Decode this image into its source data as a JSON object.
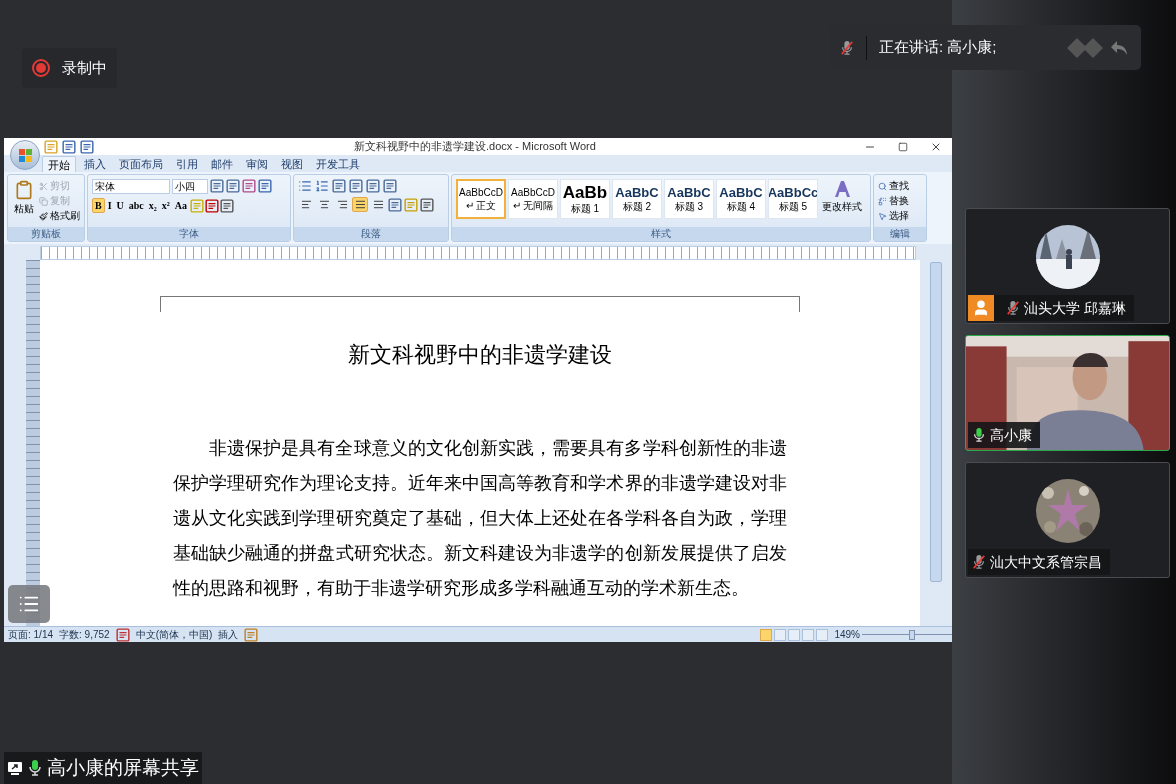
{
  "recording": {
    "on": true,
    "label": "录制中"
  },
  "speaker_bar": {
    "muted": true,
    "text": "正在讲话: 高小康;"
  },
  "word": {
    "title": "新文科视野中的非遗学建设.docx - Microsoft Word",
    "tabs": [
      {
        "label": "开始",
        "selected": true
      },
      {
        "label": "插入",
        "selected": false
      },
      {
        "label": "页面布局",
        "selected": false
      },
      {
        "label": "引用",
        "selected": false
      },
      {
        "label": "邮件",
        "selected": false
      },
      {
        "label": "审阅",
        "selected": false
      },
      {
        "label": "视图",
        "selected": false
      },
      {
        "label": "开发工具",
        "selected": false
      }
    ],
    "clipboard": {
      "paste": "粘贴",
      "items": [
        {
          "label": "剪切",
          "disabled": true
        },
        {
          "label": "复制",
          "disabled": true
        },
        {
          "label": "格式刷",
          "disabled": false
        }
      ],
      "title": "剪贴板"
    },
    "font": {
      "name": "宋体",
      "size": "小四",
      "title": "字体",
      "buttons": [
        {
          "label": "B",
          "selected": true
        },
        {
          "label": "I",
          "selected": false
        },
        {
          "label": "U",
          "selected": false
        },
        {
          "label": "abc",
          "selected": false
        },
        {
          "label": "x₂",
          "selected": false
        },
        {
          "label": "x²",
          "selected": false
        },
        {
          "label": "Aa",
          "selected": false
        }
      ]
    },
    "paragraph": {
      "title": "段落",
      "alignments": [
        {
          "kind": "left",
          "selected": false
        },
        {
          "kind": "center",
          "selected": false
        },
        {
          "kind": "right",
          "selected": false
        },
        {
          "kind": "justify",
          "selected": true
        },
        {
          "kind": "distributed",
          "selected": false
        }
      ]
    },
    "styles": {
      "title": "样式",
      "change": "更改样式",
      "items": [
        {
          "preview": "AaBbCcD",
          "label": "↵ 正文",
          "selected": true
        },
        {
          "preview": "AaBbCcD",
          "label": "↵ 无间隔",
          "selected": false
        },
        {
          "preview": "AaBb",
          "label": "标题 1",
          "selected": false
        },
        {
          "preview": "AaBbC",
          "label": "标题 2",
          "selected": false
        },
        {
          "preview": "AaBbC",
          "label": "标题 3",
          "selected": false
        },
        {
          "preview": "AaBbC",
          "label": "标题 4",
          "selected": false
        },
        {
          "preview": "AaBbCc",
          "label": "标题 5",
          "selected": false
        }
      ]
    },
    "editing": {
      "title": "编辑",
      "items": [
        {
          "kind": "find",
          "label": "查找"
        },
        {
          "kind": "replace",
          "label": "替换"
        },
        {
          "kind": "select",
          "label": "选择"
        }
      ]
    },
    "document": {
      "heading": "新文科视野中的非遗学建设",
      "paragraph": "非遗保护是具有全球意义的文化创新实践，需要具有多学科创新性的非遗保护学理研究作为理论支持。近年来中国高等教育和学术界的非遗学建设对非遗从文化实践到学理研究奠定了基础，但大体上还处在各学科各自为政，学理基础缺少融通的拼盘式研究状态。新文科建设为非遗学的创新发展提供了启发性的思路和视野，有助于非遗学研究形成多学科融通互动的学术新生态。"
    },
    "status_bar": {
      "page": "页面: 1/14",
      "words": "字数: 9,752",
      "language": "中文(简体，中国)",
      "mode": "插入",
      "zoom": "149%",
      "zoom_slider": {
        "level": 0.55
      },
      "views": [
        {
          "selected": true
        },
        {
          "selected": false
        },
        {
          "selected": false
        },
        {
          "selected": false
        },
        {
          "selected": false
        }
      ]
    }
  },
  "participants": [
    {
      "kind": "avatar",
      "name": "汕头大学 邱嘉琳",
      "muted": true,
      "active": false,
      "badge": true
    },
    {
      "kind": "video",
      "name": "高小康",
      "muted": false,
      "active": true,
      "badge": false
    },
    {
      "kind": "avatar",
      "name": "汕大中文系管宗昌",
      "muted": true,
      "active": false,
      "badge": false
    }
  ],
  "screen_share": {
    "label": "高小康的屏幕共享",
    "mic_on": true
  }
}
